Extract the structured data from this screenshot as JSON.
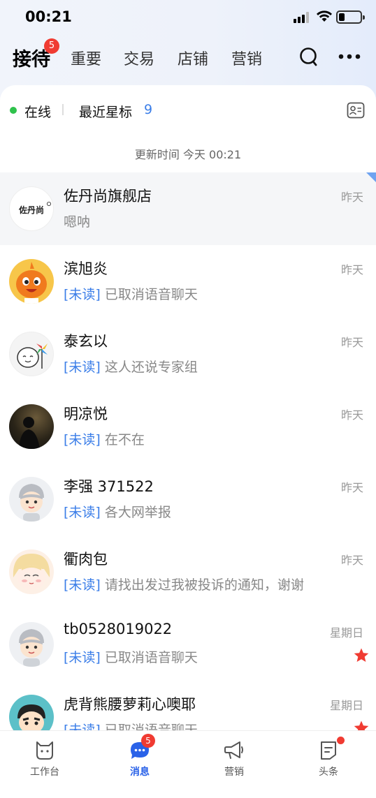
{
  "status_bar": {
    "time": "00:21"
  },
  "header": {
    "tabs": [
      {
        "label": "接待",
        "active": true,
        "badge": "5"
      },
      {
        "label": "重要"
      },
      {
        "label": "交易"
      },
      {
        "label": "店铺"
      },
      {
        "label": "营销"
      }
    ],
    "icons": [
      "search-icon",
      "more-icon"
    ]
  },
  "filter": {
    "online_label": "在线",
    "starred_label": "最近星标",
    "starred_count": "9"
  },
  "update_time": "更新时间 今天 00:21",
  "unread_tag": "[未读]",
  "conversations": [
    {
      "name": "佐丹尚旗舰店",
      "preview": "嗯呐",
      "time": "昨天",
      "unread": false,
      "pinned": true,
      "avatar": "store-logo",
      "logo_text": "佐丹尚"
    },
    {
      "name": "滨旭炎",
      "preview": "已取消语音聊天",
      "time": "昨天",
      "unread": true,
      "avatar": "orange-mascot"
    },
    {
      "name": "泰玄以",
      "preview": "这人还说专家组",
      "time": "昨天",
      "unread": true,
      "avatar": "sketch-pinwheel"
    },
    {
      "name": "明凉悦",
      "preview": "在不在",
      "time": "昨天",
      "unread": true,
      "avatar": "dark-photo"
    },
    {
      "name": "李强 371522",
      "preview": "各大网举报",
      "time": "昨天",
      "unread": true,
      "avatar": "default-avatar"
    },
    {
      "name": "衢肉包",
      "preview": "请找出发过我被投诉的通知，谢谢",
      "time": "昨天",
      "unread": true,
      "avatar": "anime-girl"
    },
    {
      "name": "tb0528019022",
      "preview": "已取消语音聊天",
      "time": "星期日",
      "unread": true,
      "starred": true,
      "avatar": "default-avatar"
    },
    {
      "name": "虎背熊腰萝莉心噢耶",
      "preview": "已取消语音聊天",
      "time": "星期日",
      "unread": true,
      "starred": true,
      "avatar": "cartoon-boy"
    }
  ],
  "bottom_nav": [
    {
      "label": "工作台",
      "icon": "workbench-icon"
    },
    {
      "label": "消息",
      "icon": "message-icon",
      "active": true,
      "badge": "5"
    },
    {
      "label": "营销",
      "icon": "megaphone-icon"
    },
    {
      "label": "头条",
      "icon": "headline-icon",
      "dot": true
    }
  ],
  "colors": {
    "accent": "#3b7ee8",
    "badge": "#f03b32",
    "online": "#2fc24c",
    "star": "#f03b32"
  }
}
